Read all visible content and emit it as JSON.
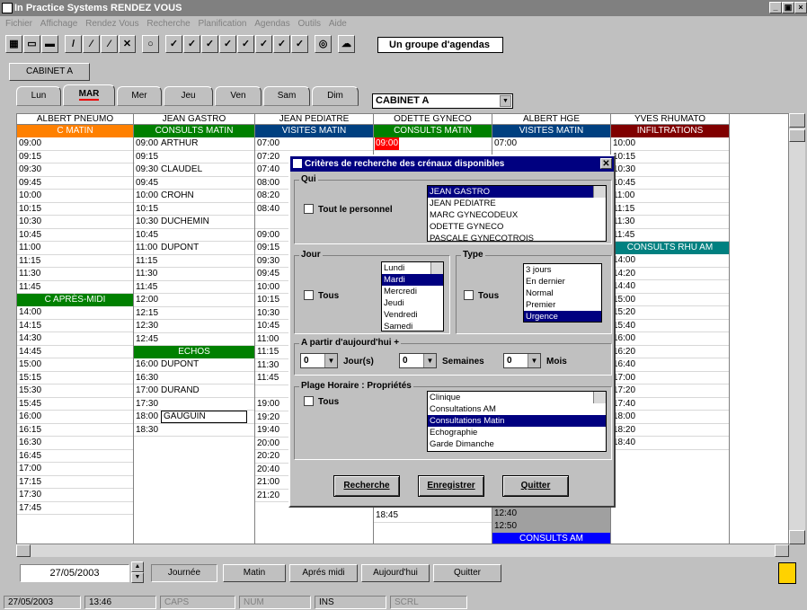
{
  "window": {
    "title": "In Practice Systems RENDEZ VOUS",
    "buttons": [
      "_",
      "▣",
      "×"
    ]
  },
  "menu": [
    "Fichier",
    "Affichage",
    "Rendez Vous",
    "Recherche",
    "Planification",
    "Agendas",
    "Outils",
    "Aide"
  ],
  "toolbar": {
    "group_label": "Un groupe d'agendas"
  },
  "cabinet_tab": "CABINET A",
  "days": [
    "Lun",
    "MAR",
    "Mer",
    "Jeu",
    "Ven",
    "Sam",
    "Dim"
  ],
  "active_day": "MAR",
  "cabinet_select": "CABINET A",
  "grid": {
    "columns": [
      {
        "name": "ALBERT PNEUMO",
        "band": "C MATIN",
        "band_color": "#ff8000",
        "rows": [
          [
            "09:00",
            ""
          ],
          [
            "09:15",
            ""
          ],
          [
            "09:30",
            ""
          ],
          [
            "09:45",
            ""
          ],
          [
            "10:00",
            ""
          ],
          [
            "10:15",
            ""
          ],
          [
            "10:30",
            ""
          ],
          [
            "10:45",
            ""
          ],
          [
            "11:00",
            ""
          ],
          [
            "11:15",
            ""
          ],
          [
            "11:30",
            ""
          ],
          [
            "11:45",
            ""
          ]
        ],
        "band2": "C APRÈS-MIDI",
        "band2_color": "#008000",
        "rows2": [
          [
            "14:00",
            ""
          ],
          [
            "14:15",
            ""
          ],
          [
            "14:30",
            ""
          ],
          [
            "14:45",
            ""
          ],
          [
            "15:00",
            ""
          ],
          [
            "15:15",
            ""
          ],
          [
            "15:30",
            ""
          ],
          [
            "15:45",
            ""
          ],
          [
            "16:00",
            ""
          ],
          [
            "16:15",
            ""
          ],
          [
            "16:30",
            ""
          ],
          [
            "16:45",
            ""
          ],
          [
            "17:00",
            ""
          ],
          [
            "17:15",
            ""
          ],
          [
            "17:30",
            ""
          ],
          [
            "17:45",
            ""
          ]
        ]
      },
      {
        "name": "JEAN GASTRO",
        "band": "CONSULTS MATIN",
        "band_color": "#008000",
        "rows": [
          [
            "09:00",
            "ARTHUR"
          ],
          [
            "09:15",
            ""
          ],
          [
            "09:30",
            "CLAUDEL"
          ],
          [
            "09:45",
            ""
          ],
          [
            "10:00",
            "CROHN"
          ],
          [
            "10:15",
            ""
          ],
          [
            "10:30",
            "DUCHEMIN"
          ],
          [
            "10:45",
            ""
          ],
          [
            "11:00",
            "DUPONT"
          ],
          [
            "11:15",
            ""
          ],
          [
            "11:30",
            ""
          ],
          [
            "11:45",
            ""
          ],
          [
            "12:00",
            ""
          ],
          [
            "12:15",
            ""
          ],
          [
            "12:30",
            ""
          ],
          [
            "12:45",
            ""
          ]
        ],
        "band2": "ECHOS",
        "band2_color": "#008000",
        "rows2": [
          [
            "16:00",
            "DUPONT"
          ],
          [
            "16:30",
            ""
          ],
          [
            "17:00",
            "DURAND"
          ],
          [
            "17:30",
            ""
          ],
          [
            "18:00",
            "GAUGUIN"
          ],
          [
            "18:30",
            ""
          ]
        ]
      },
      {
        "name": "JEAN PEDIATRE",
        "band": "VISITES MATIN",
        "band_color": "#004080",
        "rows": [
          [
            "07:00",
            ""
          ],
          [
            "07:20",
            ""
          ],
          [
            "07:40",
            ""
          ],
          [
            "08:00",
            ""
          ],
          [
            "08:20",
            ""
          ],
          [
            "08:40",
            ""
          ],
          [
            "",
            ""
          ],
          [
            "09:00",
            ""
          ],
          [
            "09:15",
            ""
          ],
          [
            "09:30",
            ""
          ],
          [
            "09:45",
            ""
          ],
          [
            "10:00",
            ""
          ],
          [
            "10:15",
            ""
          ],
          [
            "10:30",
            ""
          ],
          [
            "10:45",
            ""
          ],
          [
            "11:00",
            ""
          ],
          [
            "11:15",
            ""
          ],
          [
            "11:30",
            ""
          ],
          [
            "11:45",
            ""
          ],
          [
            "",
            ""
          ],
          [
            "19:00",
            ""
          ],
          [
            "19:20",
            ""
          ],
          [
            "19:40",
            ""
          ],
          [
            "20:00",
            ""
          ],
          [
            "20:20",
            ""
          ],
          [
            "20:40",
            ""
          ],
          [
            "21:00",
            ""
          ],
          [
            "21:20",
            ""
          ]
        ]
      },
      {
        "name": "ODETTE GYNECO",
        "band": "CONSULTS MATIN",
        "band_color": "#008000",
        "first_time": "09:00",
        "late_time": "18:45"
      },
      {
        "name": "ALBERT HGE",
        "band": "VISITES MATIN",
        "band_color": "#004080",
        "first_time": "07:00",
        "late_times": [
          "12:40",
          "12:50"
        ],
        "band3": "CONSULTS AM",
        "band3_color": "#0000ff"
      },
      {
        "name": "YVES RHUMATO",
        "band": "INFILTRATIONS",
        "band_color": "#800000",
        "rows": [
          "10:00",
          "10:15",
          "10:30",
          "10:45",
          "11:00",
          "11:15",
          "11:30",
          "11:45"
        ],
        "band2": "CONSULTS RHU AM",
        "band2_color": "#008080",
        "rows2": [
          "14:00",
          "14:20",
          "14:40",
          "15:00",
          "15:20",
          "15:40",
          "16:00",
          "16:20",
          "16:40",
          "17:00",
          "17:20",
          "17:40",
          "18:00",
          "18:20",
          "18:40"
        ]
      }
    ]
  },
  "dialog": {
    "title": "Critères de recherche des crénaux disponibles",
    "qui": {
      "label": "Qui",
      "check": "Tout le personnel",
      "items": [
        "JEAN GASTRO",
        "JEAN PEDIATRE",
        "MARC GYNECODEUX",
        "ODETTE GYNECO",
        "PASCALE GYNECOTROIS"
      ],
      "selected": 0
    },
    "jour": {
      "label": "Jour",
      "check": "Tous",
      "items": [
        "Lundi",
        "Mardi",
        "Mercredi",
        "Jeudi",
        "Vendredi",
        "Samedi"
      ],
      "selected": 1
    },
    "type": {
      "label": "Type",
      "check": "Tous",
      "items": [
        "3 jours",
        "En dernier",
        "Normal",
        "Premier",
        "Urgence"
      ],
      "selected": 4
    },
    "apartir": {
      "label": "A partir d'aujourd'hui +",
      "jours_val": "0",
      "jours_label": "Jour(s)",
      "sem_val": "0",
      "sem_label": "Semaines",
      "mois_val": "0",
      "mois_label": "Mois"
    },
    "plage": {
      "label": "Plage Horaire : Propriétés",
      "check": "Tous",
      "items": [
        "Clinique",
        "Consultations AM",
        "Consultations Matin",
        "Echographie",
        "Garde Dimanche"
      ],
      "selected": 2
    },
    "buttons": {
      "search": "Recherche",
      "save": "Enregistrer",
      "quit": "Quitter"
    }
  },
  "bottom": {
    "date": "27/05/2003",
    "buttons": [
      "Journée",
      "Matin",
      "Aprés midi",
      "Aujourd'hui",
      "Quitter"
    ]
  },
  "status": [
    "27/05/2003",
    "13:46",
    "CAPS",
    "NUM",
    "INS",
    "SCRL"
  ]
}
